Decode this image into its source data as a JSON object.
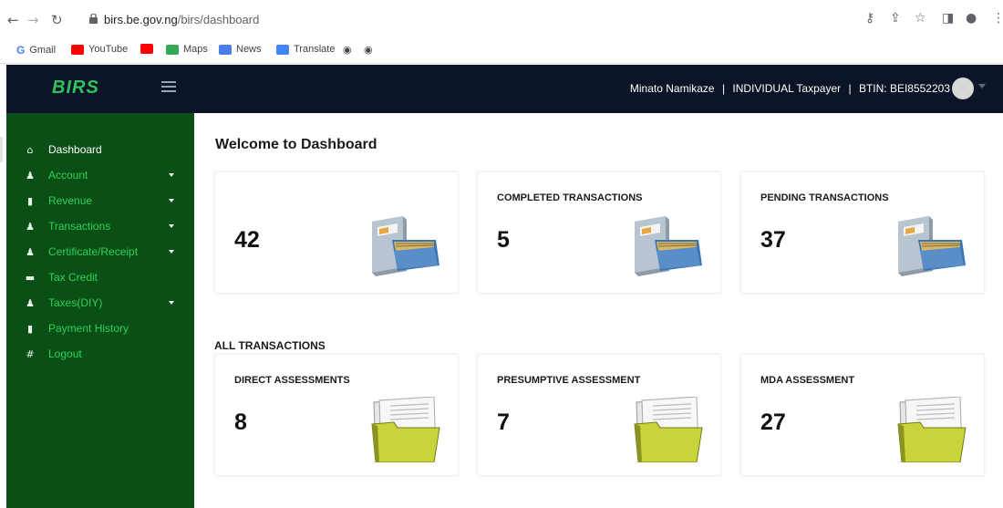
{
  "browser": {
    "url_host": "birs.be.gov.ng",
    "url_path": "/birs/dashboard",
    "bookmarks": [
      "Gmail",
      "YouTube",
      "Maps",
      "News",
      "Translate"
    ]
  },
  "header": {
    "logo_text": "BIRS",
    "user_name": "Minato Namikaze",
    "user_type": "INDIVIDUAL Taxpayer",
    "btin": "BTIN: BEI8552203",
    "separator": "|"
  },
  "sidebar": {
    "items": [
      {
        "label": "Dashboard",
        "icon": "home-icon"
      },
      {
        "label": "Account",
        "icon": "user-icon"
      },
      {
        "label": "Revenue",
        "icon": "file-icon"
      },
      {
        "label": "Transactions",
        "icon": "user-icon"
      },
      {
        "label": "Certificate/Receipt",
        "icon": "user-icon"
      },
      {
        "label": "Tax Credit",
        "icon": "comment-icon"
      },
      {
        "label": "Taxes(DIY)",
        "icon": "user-icon"
      },
      {
        "label": "Payment History",
        "icon": "file-icon"
      },
      {
        "label": "Logout",
        "icon": "hash-icon"
      }
    ]
  },
  "main": {
    "title": "Welcome to Dashboard",
    "top_cards": [
      {
        "label": "",
        "value": "42"
      },
      {
        "label": "COMPLETED TRANSACTIONS",
        "value": "5"
      },
      {
        "label": "PENDING TRANSACTIONS",
        "value": "37"
      }
    ],
    "section_title": "ALL TRANSACTIONS",
    "bottom_cards": [
      {
        "label": "DIRECT ASSESSMENTS",
        "value": "8"
      },
      {
        "label": "PRESUMPTIVE ASSESSMENT",
        "value": "7"
      },
      {
        "label": "MDA ASSESSMENT",
        "value": "27"
      }
    ]
  },
  "colors": {
    "header_bg": "#0c1427",
    "sidebar_bg": "#0a4f16",
    "sidebar_text": "#2ed05a",
    "logo": "#2fc25b"
  }
}
